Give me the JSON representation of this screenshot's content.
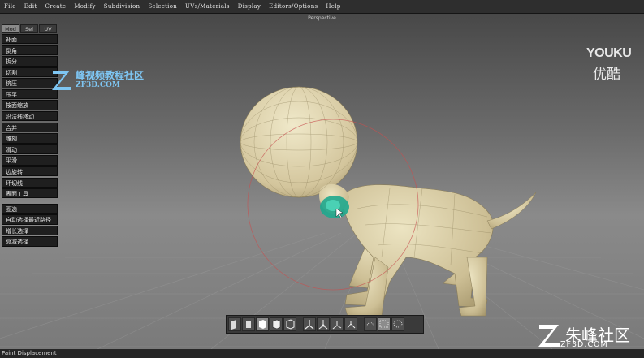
{
  "menubar": {
    "items": [
      "File",
      "Edit",
      "Create",
      "Modify",
      "Subdivision",
      "Selection",
      "UVs/Materials",
      "Display",
      "Editors/Options",
      "Help"
    ]
  },
  "viewport": {
    "title": "Perspective"
  },
  "tool_panel": {
    "tabs": [
      {
        "label": "Mod",
        "active": true
      },
      {
        "label": "Sel",
        "active": false
      },
      {
        "label": "UV",
        "active": false
      }
    ],
    "group1": [
      "补面",
      "倒角",
      "拆分",
      "切割",
      "挤压",
      "压平",
      "按面缩放",
      "沿法线移动",
      "合并",
      "雕刻",
      "滑动",
      "平滑",
      "边旋转",
      "环切线",
      "表面工具"
    ],
    "group2": [
      "圈选",
      "自动选择最近路径",
      "增长选择",
      "衰减选择"
    ]
  },
  "bottom_toolbar": {
    "icons": [
      "view-front-icon",
      "view-side-icon",
      "view-solid-icon",
      "view-shaded-icon",
      "view-cube-icon",
      "axis-icon",
      "axis-move-icon",
      "axis-rotate-icon",
      "axis-scale-icon",
      "wire-icon",
      "select-box-icon",
      "select-lasso-icon"
    ]
  },
  "statusbar": {
    "text": "Paint Displacement"
  },
  "watermarks": {
    "zf_cn": "峰视频教程社区",
    "zf_en": "ZF3D.COM",
    "youku_en": "YOUKU",
    "youku_cn": "优酷",
    "brand_cn": "朱峰社区",
    "brand_url": "ZF3D.COM"
  },
  "colors": {
    "model": "#d8cfa8",
    "brush": "#1fa88e",
    "brush_ring": "#c85050",
    "accent_blue": "#7ec6f3"
  }
}
